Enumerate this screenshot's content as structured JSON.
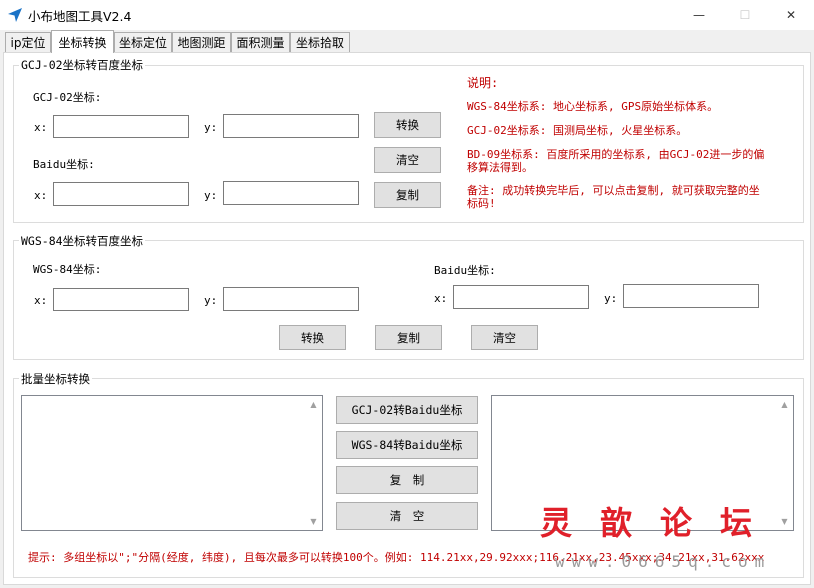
{
  "window": {
    "title": "小布地图工具V2.4",
    "minimize_glyph": "—",
    "maximize_glyph": "☐",
    "close_glyph": "✕"
  },
  "tabs": [
    {
      "label": "ip定位",
      "active": false
    },
    {
      "label": "坐标转换",
      "active": true
    },
    {
      "label": "坐标定位",
      "active": false
    },
    {
      "label": "地图测距",
      "active": false
    },
    {
      "label": "面积测量",
      "active": false
    },
    {
      "label": "坐标拾取",
      "active": false
    }
  ],
  "gcj_section": {
    "title": "GCJ-02坐标转百度坐标",
    "gcj_label": "GCJ-02坐标:",
    "baidu_label": "Baidu坐标:",
    "x_label": "x:",
    "y_label": "y:",
    "gcj_x": "",
    "gcj_y": "",
    "baidu_x": "",
    "baidu_y": "",
    "convert_button": "转换",
    "clear_button": "清空",
    "copy_button": "复制"
  },
  "notes": {
    "heading": "说明:",
    "wgs": "WGS-84坐标系: 地心坐标系, GPS原始坐标体系。",
    "gcj": "GCJ-02坐标系: 国测局坐标, 火星坐标系。",
    "bd_line1": "BD-09坐标系: 百度所采用的坐标系, 由GCJ-02进一步的偏",
    "bd_line2": "移算法得到。",
    "tip_line1": "备注: 成功转换完毕后, 可以点击复制, 就可获取完整的坐",
    "tip_line2": "标码!"
  },
  "wgs_section": {
    "title": "WGS-84坐标转百度坐标",
    "wgs_label": "WGS-84坐标:",
    "baidu_label": "Baidu坐标:",
    "x_label": "x:",
    "y_label": "y:",
    "wgs_x": "",
    "wgs_y": "",
    "baidu_x": "",
    "baidu_y": "",
    "convert_button": "转换",
    "copy_button": "复制",
    "clear_button": "清空"
  },
  "batch_section": {
    "title": "批量坐标转换",
    "input_text": "",
    "output_text": "",
    "gcj_to_baidu_button": "GCJ-02转Baidu坐标",
    "wgs_to_baidu_button": "WGS-84转Baidu坐标",
    "copy_button": "复　制",
    "clear_button": "清　空",
    "hint": "提示: 多组坐标以\";\"分隔(经度, 纬度), 且每次最多可以转换100个。例如: 114.21xx,29.92xxx;116.21xx,23.45xxx;34.21xx,31.62xxx"
  },
  "watermark": {
    "text": "灵歆论坛",
    "url": "www.0665q.com"
  }
}
